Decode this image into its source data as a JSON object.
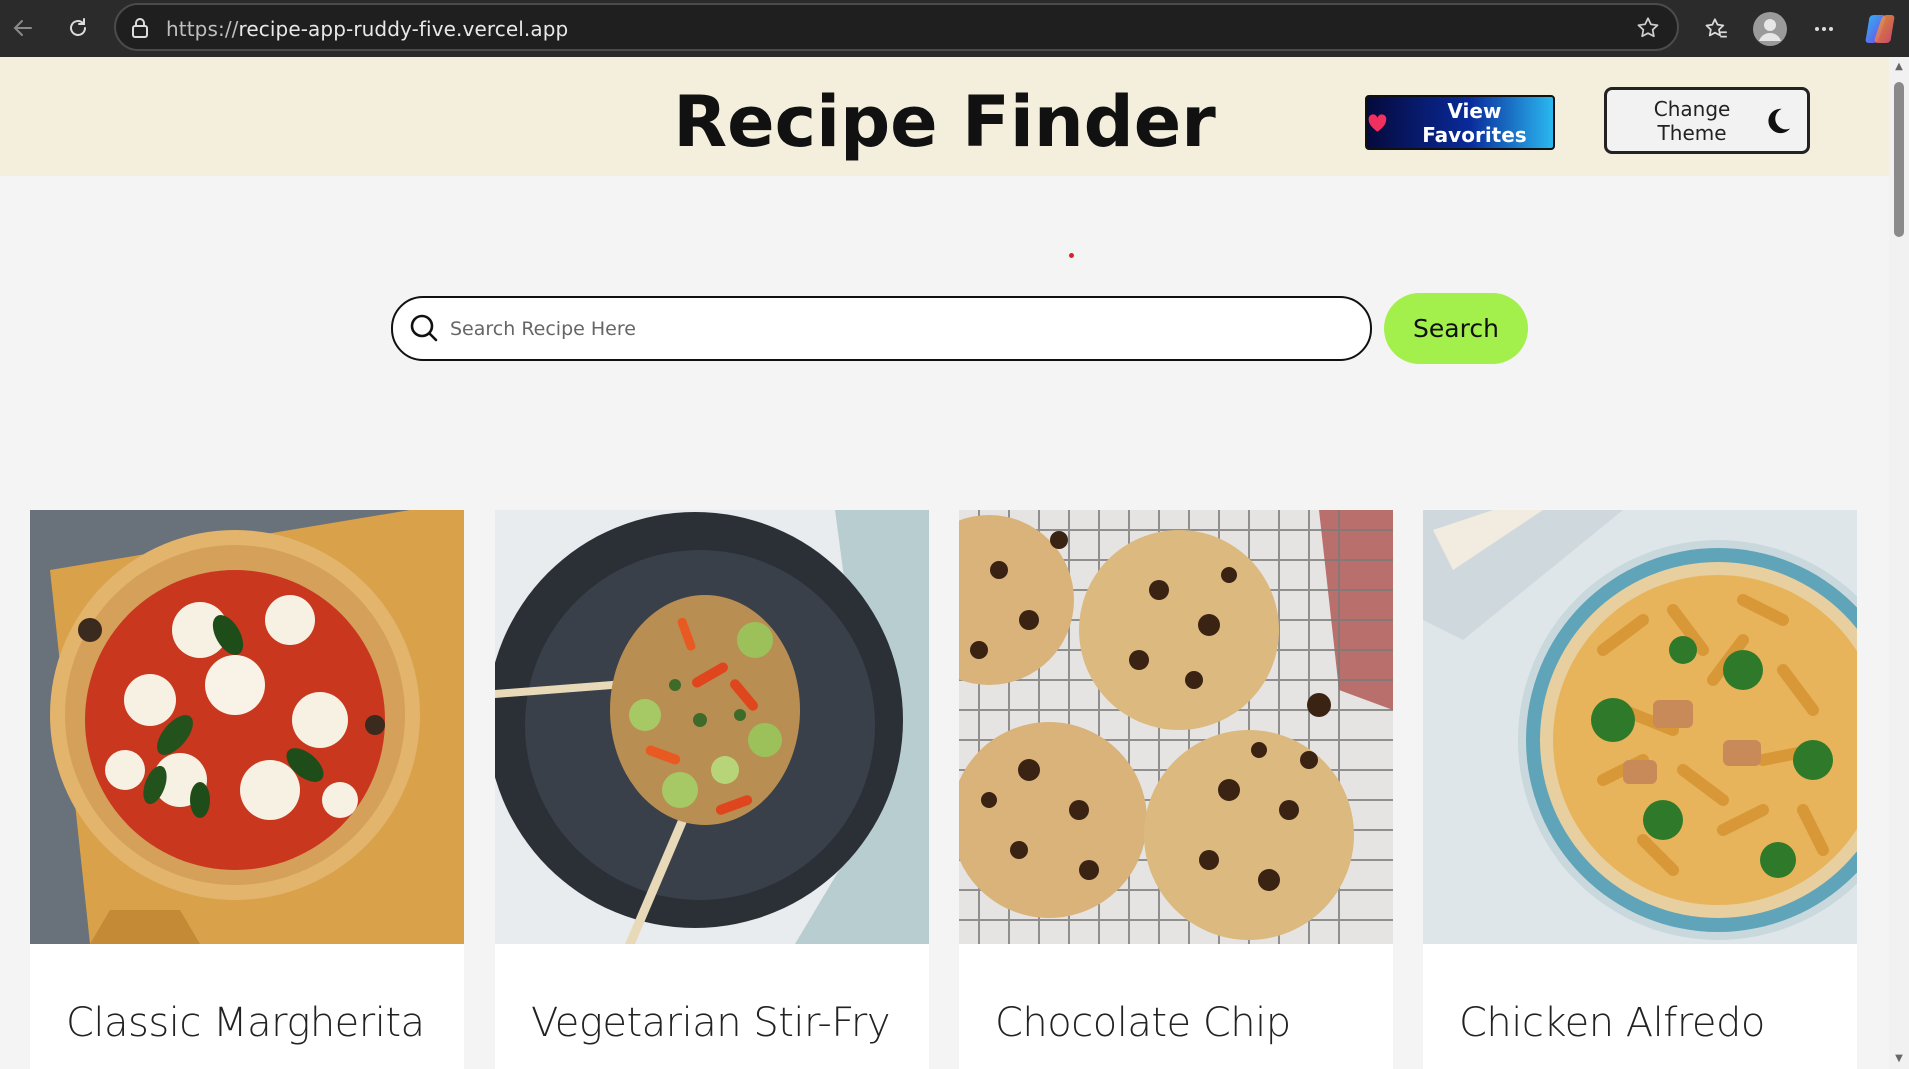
{
  "browser": {
    "url_scheme": "https://",
    "url_host": "recipe-app-ruddy-five.vercel.app"
  },
  "header": {
    "title": "Recipe Finder",
    "favorites_label": "View Favorites",
    "theme_label": "Change Theme"
  },
  "search": {
    "placeholder": "Search Recipe Here",
    "value": "",
    "button_label": "Search"
  },
  "recipes": [
    {
      "name": "Classic Margherita",
      "image": "pizza"
    },
    {
      "name": "Vegetarian Stir-Fry",
      "image": "stir-fry"
    },
    {
      "name": "Chocolate Chip",
      "image": "cookies"
    },
    {
      "name": "Chicken Alfredo",
      "image": "pasta"
    }
  ],
  "colors": {
    "header_bg": "#f4eedd",
    "search_button": "#a3ef4c",
    "page_bg": "#f4f4f4"
  }
}
